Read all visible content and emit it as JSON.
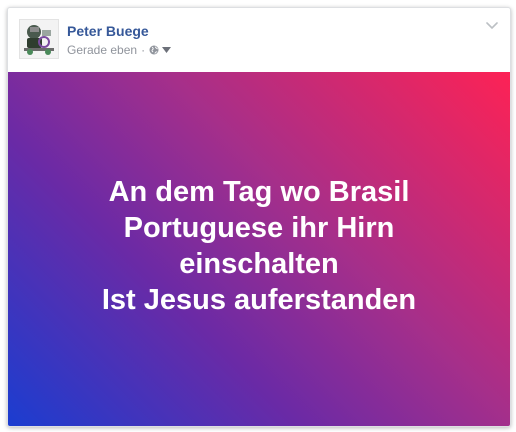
{
  "post": {
    "author": "Peter Buege",
    "timestamp": "Gerade eben",
    "separator": "·",
    "privacy_icon": "globe-icon",
    "audience_icon": "caret-down-icon",
    "menu_icon": "chevron-down-icon",
    "text_lines": [
      "An dem Tag wo Brasil",
      "Portuguese ihr Hirn",
      "einschalten",
      "Ist Jesus auferstanden"
    ],
    "colors": {
      "author": "#365899",
      "meta": "#90949c",
      "gradient": [
        "#1b3dd0",
        "#6a2aa6",
        "#a62f8a",
        "#fd2255"
      ]
    }
  }
}
